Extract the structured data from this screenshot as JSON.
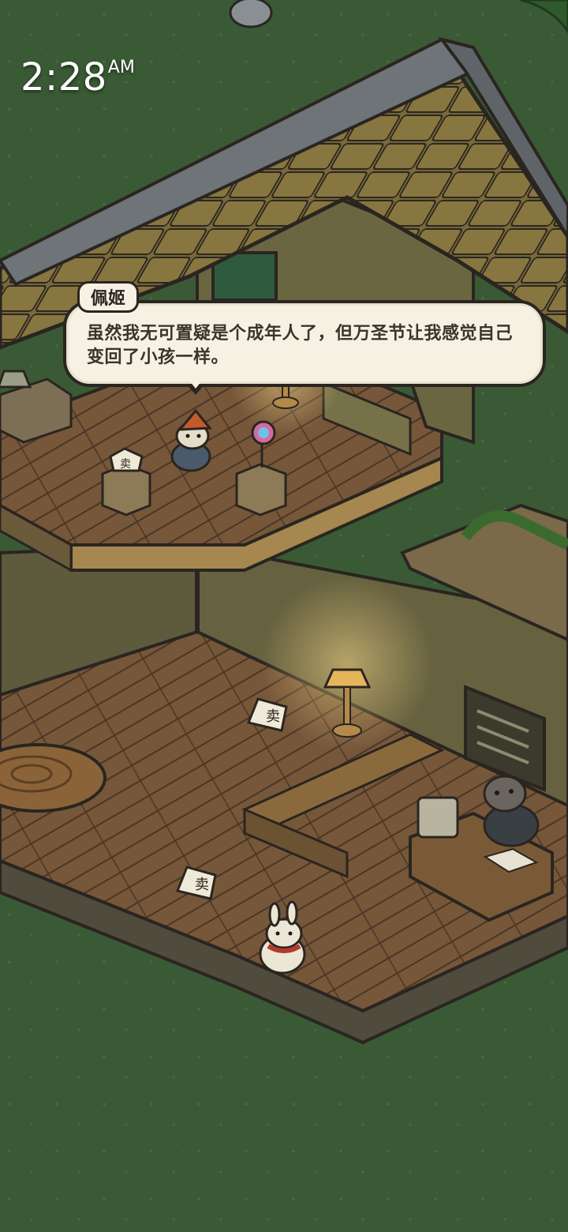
{
  "status_bar": {
    "time": "2:28",
    "ampm": "AM"
  },
  "dialog": {
    "speaker": "佩姬",
    "text": "虽然我无可置疑是个成年人了，但万圣节让我感觉自己变回了小孩一样。"
  },
  "signs": {
    "sale_label": "卖"
  },
  "colors": {
    "grass": "#3a5a35",
    "floor": "#7a5a36",
    "wall": "#5e5a3e",
    "roof_tile": "#7a6a3a",
    "lamp_glow": "#f2c86a",
    "dialog_bg": "#f6f1e3",
    "outline": "#2a2520"
  }
}
